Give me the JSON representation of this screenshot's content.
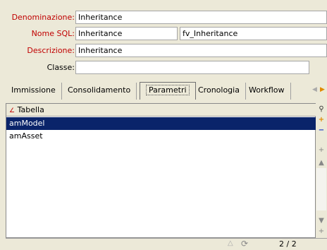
{
  "form": {
    "denominazione": {
      "label": "Denominazione:",
      "value": "Inheritance"
    },
    "nome_sql": {
      "label": "Nome SQL:",
      "value": "Inheritance",
      "extra": "fv_Inheritance"
    },
    "descrizione": {
      "label": "Descrizione:",
      "value": "Inheritance"
    },
    "classe": {
      "label": "Classe:",
      "value": ""
    }
  },
  "tabs": [
    "Immissione",
    "Consolidamento",
    "Parametri",
    "Cronologia",
    "Workflow"
  ],
  "active_tab": "Parametri",
  "list": {
    "column": "Tabella",
    "items": [
      "amModel",
      "amAsset"
    ],
    "selected": "amModel"
  },
  "status": {
    "page": "2 / 2"
  },
  "colors": {
    "label_red": "#c00000",
    "selection": "#0a246a",
    "background": "#ece9d8"
  }
}
